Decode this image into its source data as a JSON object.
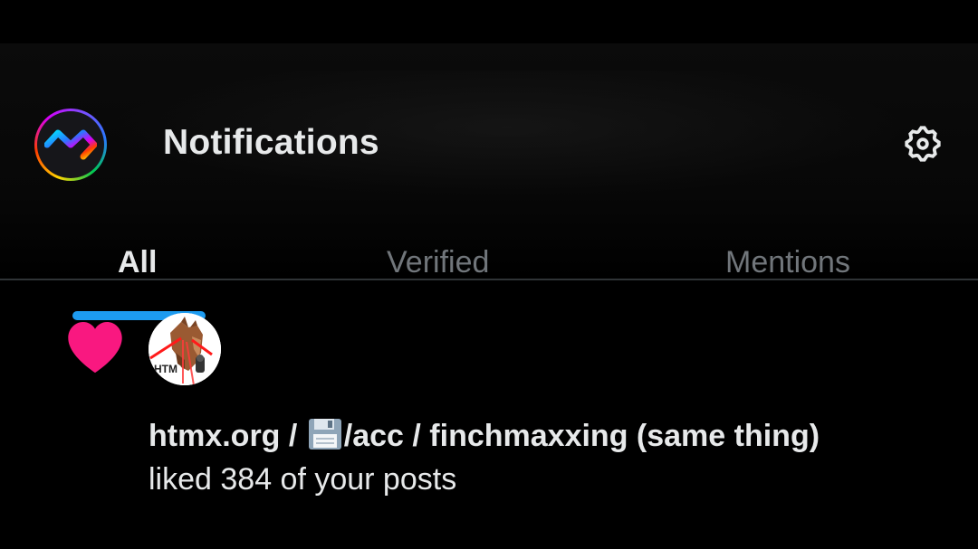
{
  "header": {
    "logo_icon": "rainbow-chevron-logo",
    "title": "Notifications",
    "settings_icon": "gear-icon"
  },
  "tabs": [
    {
      "label": "All",
      "active": true
    },
    {
      "label": "Verified",
      "active": false
    },
    {
      "label": "Mentions",
      "active": false
    }
  ],
  "notification": {
    "type_icon": "heart-icon",
    "type_color": "#f91880",
    "avatar_icon": "horse-laser-eyes-avatar",
    "avatar_text": "HTM",
    "actor_prefix": "htmx.org / ",
    "actor_emoji_icon": "floppy-disk-icon",
    "actor_suffix": "/acc / finchmaxxing (same thing)",
    "action_text": "liked 384 of your posts"
  },
  "colors": {
    "background": "#000000",
    "text_primary": "#e7e9ea",
    "text_secondary": "#71767b",
    "accent": "#1d9bf0",
    "like": "#f91880",
    "divider": "#2f3336"
  }
}
